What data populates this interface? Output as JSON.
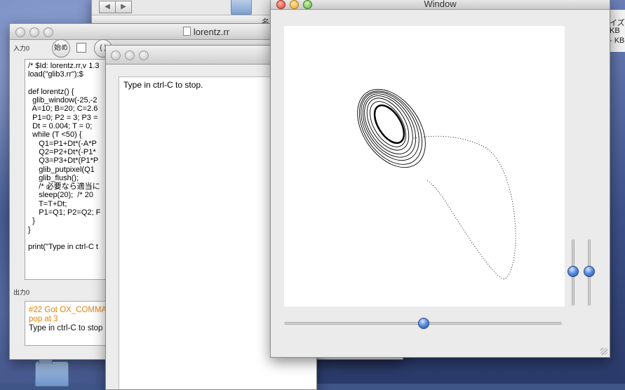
{
  "finder": {
    "partial_column_text": "名",
    "right_strip": [
      "イズ",
      "KB",
      "- KB"
    ]
  },
  "editor_window": {
    "title": "lorentz.rr",
    "input_label": "入力0",
    "start_button": "始め",
    "brace_button": "{ }",
    "code": "/* $Id: lorentz.rr,v 1.3\nload(\"glib3.rr\");$\n\ndef lorentz() {\n  glib_window(-25,-2\n  A=10; B=20; C=2.6\n  P1=0; P2 = 3; P3 =\n  Dt = 0.004; T = 0;\n  while (T <50) {\n     Q1=P1+Dt*(-A*P\n     Q2=P2+Dt*(-P1*\n     Q3=P3+Dt*(P1*P\n     glib_putpixel(Q1\n     glib_flush();\n     /* 必要なら適当に\n     sleep(20);  /* 20 \n     T=T+Dt;\n     P1=Q1; P2=Q2; F\n  }\n}\n\nprint(\"Type in ctrl-C t",
    "output_label": "出力0",
    "output_lines": [
      {
        "text": "#22 Got OX_COMMA",
        "color": "#e2830e"
      },
      {
        "text": "pop at 3",
        "color": "#e2830e"
      },
      {
        "text": "Type in ctrl-C to stop",
        "color": "#111111"
      }
    ]
  },
  "output_window": {
    "text": "Type in ctrl-C to stop."
  },
  "graphics_window": {
    "title": "Window",
    "slider_h_value": 0.5,
    "slider_v1_value": 0.5,
    "slider_v2_value": 0.5
  }
}
